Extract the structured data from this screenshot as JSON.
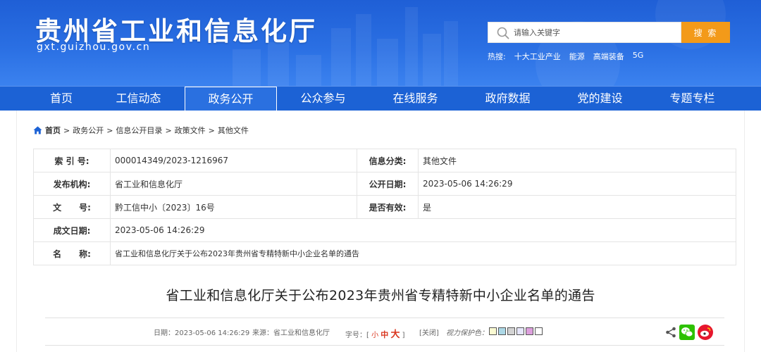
{
  "header": {
    "site_title": "贵州省工业和信息化厅",
    "site_url": "gxt.guizhou.gov.cn",
    "search": {
      "placeholder": "请输入关键字",
      "button_label": "搜 索"
    },
    "hot_words": {
      "label": "热搜:",
      "items": [
        "十大工业产业",
        "能源",
        "高端装备",
        "5G"
      ]
    }
  },
  "nav": {
    "items": [
      "首页",
      "工信动态",
      "政务公开",
      "公众参与",
      "在线服务",
      "政府数据",
      "党的建设",
      "专题专栏"
    ],
    "active": "政务公开"
  },
  "breadcrumb": {
    "items": [
      "首页",
      "政务公开",
      "信息公开目录",
      "政策文件",
      "其他文件"
    ],
    "separator": ">"
  },
  "info_table": {
    "index_label": "索 引 号:",
    "index_value": "000014349/2023-1216967",
    "category_label": "信息分类:",
    "category_value": "其他文件",
    "publisher_label": "发布机构:",
    "publisher_value": "省工业和信息化厅",
    "publish_date_label": "公开日期:",
    "publish_date_value": "2023-05-06 14:26:29",
    "doc_no_label": "文      号:",
    "doc_no_value": "黔工信中小〔2023〕16号",
    "valid_label": "是否有效:",
    "valid_value": "是",
    "created_label": "成文日期:",
    "created_value": "2023-05-06 14:26:29",
    "name_label": "名      称:",
    "name_value": "省工业和信息化厅关于公布2023年贵州省专精特新中小企业名单的通告"
  },
  "article": {
    "title": "省工业和信息化厅关于公布2023年贵州省专精特新中小企业名单的通告",
    "meta": {
      "date": "日期：2023-05-06 14:26:29",
      "source": "来源：省工业和信息化厅",
      "font_label": "字号：[",
      "font_small": "小",
      "font_mid": "中",
      "font_big": "大",
      "font_end": "]",
      "close": "[关闭]",
      "vision_label": "视力保护色："
    },
    "swatch_colors": [
      "#fafad2",
      "#add8e6",
      "#d3d3d3",
      "#e6e6fa",
      "#dda0dd",
      "#ffffff"
    ]
  },
  "colors": {
    "header_blue": "#2a6fe3",
    "nav_blue": "#1c62d5",
    "search_orange": "#f39a19",
    "accent_red": "#d9341c",
    "wechat_green": "#2dc100",
    "weibo_red": "#e6162d"
  }
}
